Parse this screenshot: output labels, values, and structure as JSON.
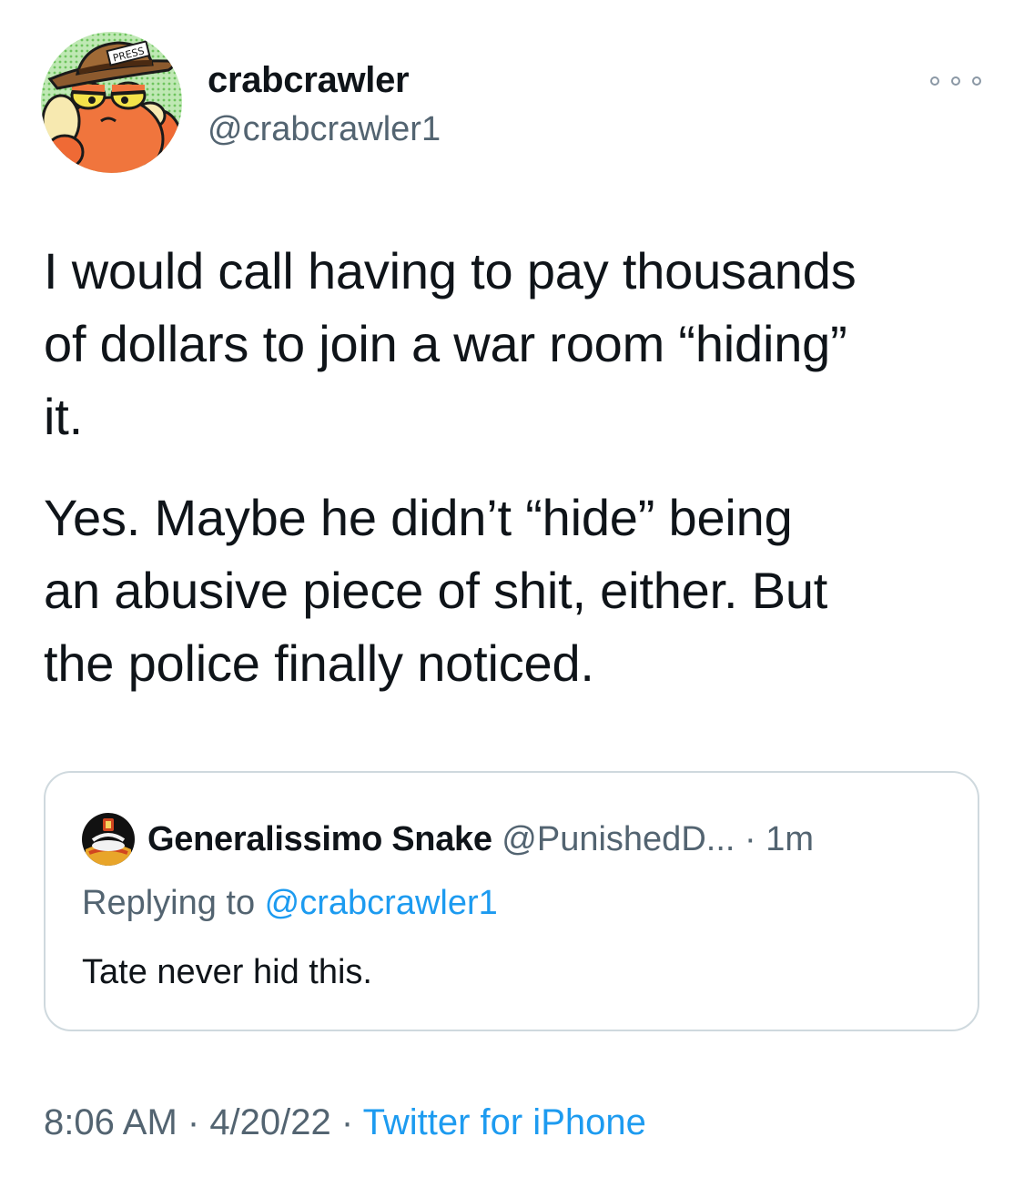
{
  "author": {
    "display_name": "crabcrawler",
    "handle": "@crabcrawler1",
    "avatar_label": "PRESS"
  },
  "tweet": {
    "paragraphs": [
      "I would call having to pay thousands\nof dollars to join a war room “hiding”\nit.",
      "Yes. Maybe he didn’t “hide” being\nan abusive piece of shit, either. But\nthe police finally noticed."
    ]
  },
  "quoted_tweet": {
    "display_name": "Generalissimo Snake",
    "handle": "@PunishedD...",
    "separator": " · ",
    "time": "1m",
    "replying_prefix": "Replying to ",
    "replying_to": "@crabcrawler1",
    "text": "Tate never hid this."
  },
  "meta": {
    "time": "8:06 AM",
    "separator_1": " · ",
    "date": "4/20/22",
    "separator_2": " · ",
    "source": "Twitter for iPhone"
  },
  "icons": {
    "more": "more-horizontal-icon"
  },
  "colors": {
    "text": "#0f1419",
    "secondary": "#536471",
    "link": "#1d9bf0",
    "border": "#cfd9de"
  }
}
